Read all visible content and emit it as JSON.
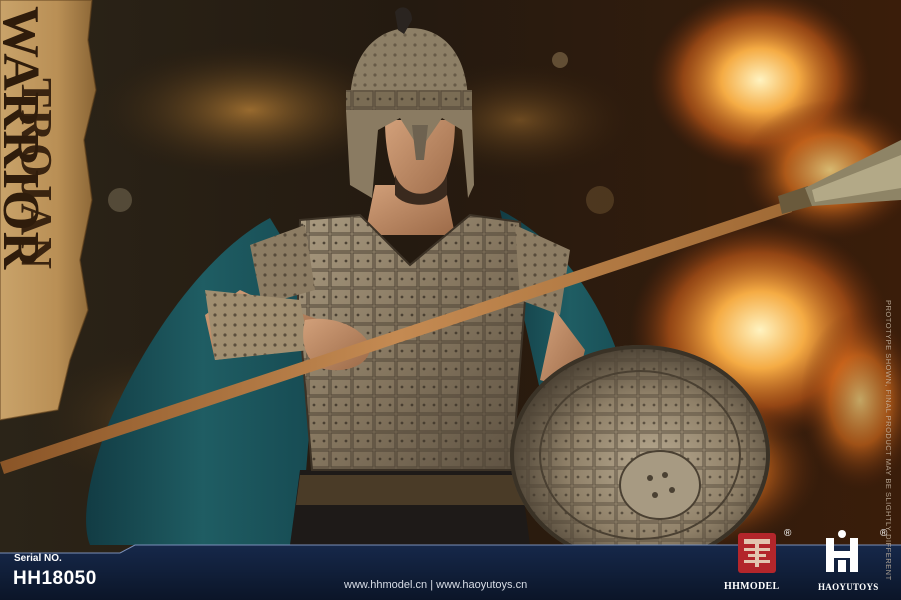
{
  "product": {
    "title_line1": "TROJAN",
    "title_line2": "WARRIOR",
    "serial_label": "Serial NO.",
    "serial_number": "HH18050",
    "websites": "www.hhmodel.cn  |  www.haoyutoys.cn",
    "disclaimer": "PROTOTYPE SHOWN, FINAL PRODUCT MAY BE SLIGHTLY DIFFERENT"
  },
  "brands": {
    "hhmodel": "HHMODEL",
    "haoyutoys": "HAOYUTOYS",
    "registered_mark": "®"
  },
  "colors": {
    "footer_bg": "#0f1c33",
    "cape": "#1f5d63",
    "armor": "#9a8a72",
    "fire": "#ff8a1e",
    "hh_logo_red": "#b3262b"
  }
}
